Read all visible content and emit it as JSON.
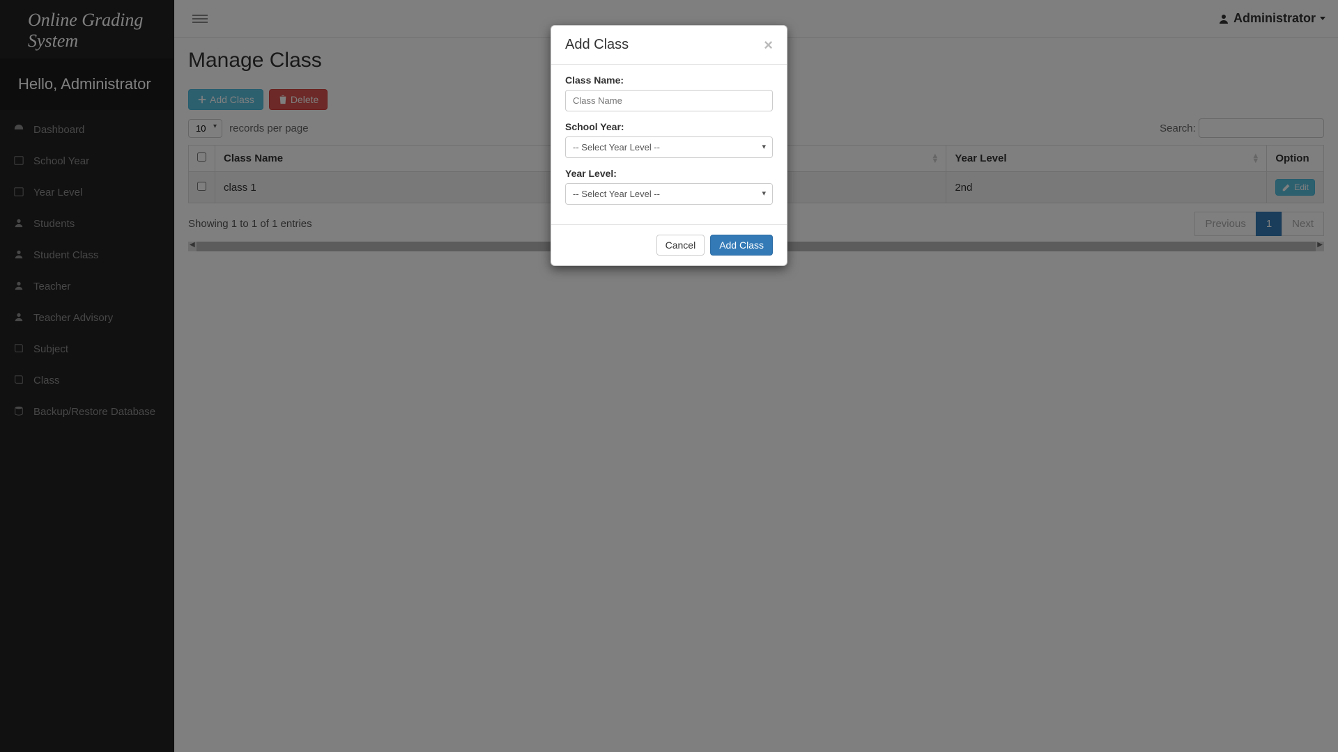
{
  "brand": "Online Grading System",
  "greeting": "Hello, Administrator",
  "user_label": "Administrator",
  "sidebar": {
    "items": [
      {
        "label": "Dashboard"
      },
      {
        "label": "School Year"
      },
      {
        "label": "Year Level"
      },
      {
        "label": "Students"
      },
      {
        "label": "Student Class"
      },
      {
        "label": "Teacher"
      },
      {
        "label": "Teacher Advisory"
      },
      {
        "label": "Subject"
      },
      {
        "label": "Class"
      },
      {
        "label": "Backup/Restore Database"
      }
    ]
  },
  "page": {
    "title": "Manage Class",
    "add_btn": "Add Class",
    "delete_btn": "Delete",
    "records_per_page_label": "records per page",
    "length_value": "10",
    "search_label": "Search:",
    "columns": {
      "class_name": "Class Name",
      "year_level": "Year Level",
      "option": "Option"
    },
    "rows": [
      {
        "class_name": "class 1",
        "year_level": "2nd",
        "edit_label": "Edit"
      }
    ],
    "info_text": "Showing 1 to 1 of 1 entries",
    "pagination": {
      "previous": "Previous",
      "current": "1",
      "next": "Next"
    }
  },
  "modal": {
    "title": "Add Class",
    "class_name_label": "Class Name:",
    "class_name_placeholder": "Class Name",
    "school_year_label": "School Year:",
    "school_year_selected": "-- Select Year Level --",
    "year_level_label": "Year Level:",
    "year_level_selected": "-- Select Year Level --",
    "cancel": "Cancel",
    "submit": "Add Class"
  }
}
